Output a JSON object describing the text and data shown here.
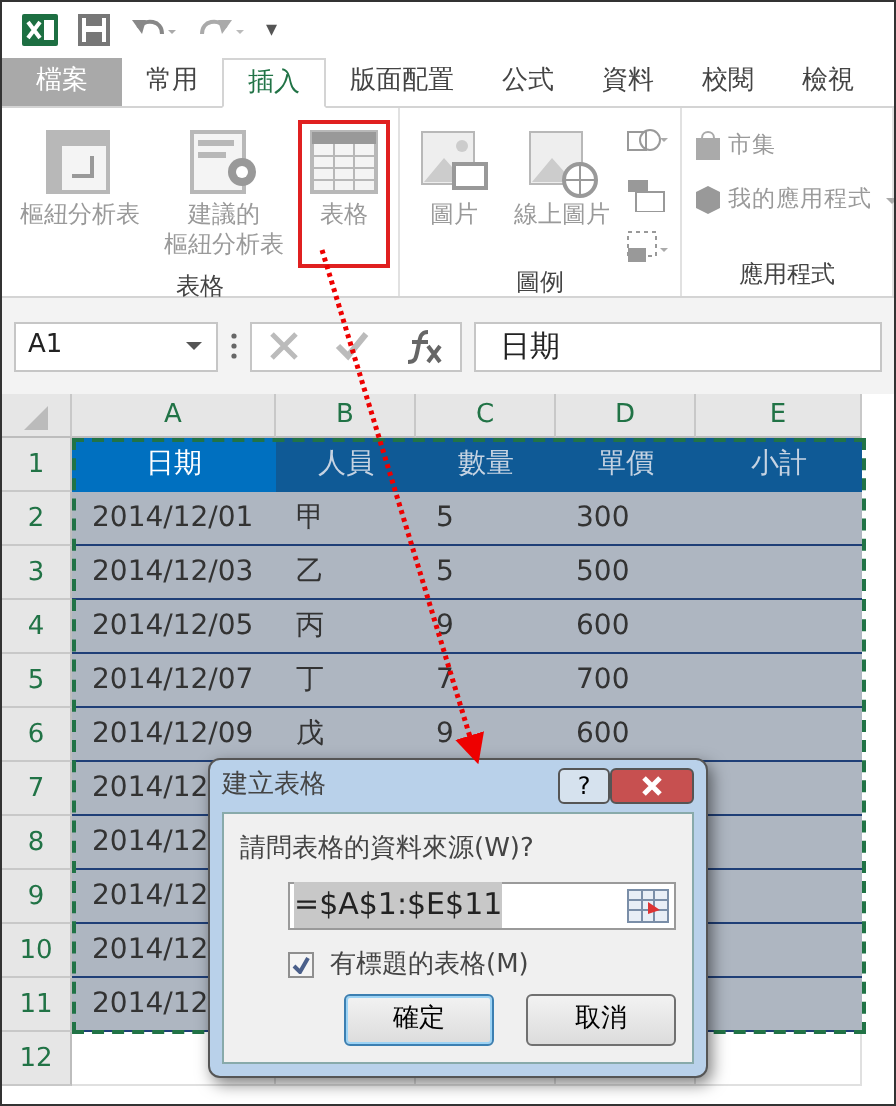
{
  "quick_access": {
    "customize_glyph": "▾"
  },
  "tabs": [
    {
      "label": "檔案",
      "kind": "file",
      "selected": false
    },
    {
      "label": "常用",
      "kind": "tab",
      "selected": false
    },
    {
      "label": "插入",
      "kind": "tab",
      "selected": true
    },
    {
      "label": "版面配置",
      "kind": "tab",
      "selected": false
    },
    {
      "label": "公式",
      "kind": "tab",
      "selected": false
    },
    {
      "label": "資料",
      "kind": "tab",
      "selected": false
    },
    {
      "label": "校閱",
      "kind": "tab",
      "selected": false
    },
    {
      "label": "檢視",
      "kind": "tab",
      "selected": false
    }
  ],
  "ribbon_groups": [
    {
      "label": "表格",
      "kind": "large",
      "items": [
        {
          "label_lines": [
            "樞紐分析表"
          ],
          "highlighted": false
        },
        {
          "label_lines": [
            "建議的",
            "樞紐分析表"
          ],
          "highlighted": false
        },
        {
          "label_lines": [
            "表格"
          ],
          "highlighted": true
        }
      ]
    },
    {
      "label": "圖例",
      "kind": "large_with_small",
      "items": [
        {
          "label_lines": [
            "圖片"
          ],
          "highlighted": false
        },
        {
          "label_lines": [
            "線上圖片"
          ],
          "highlighted": false
        }
      ]
    },
    {
      "label": "應用程式",
      "kind": "list",
      "items": [
        {
          "label": "市集",
          "dropdown": false
        },
        {
          "label": "我的應用程式",
          "dropdown": true
        }
      ]
    }
  ],
  "name_box": "A1",
  "formula": "日期",
  "columns": [
    "A",
    "B",
    "C",
    "D",
    "E"
  ],
  "table": {
    "marquee": true,
    "rows": [
      {
        "number": "1",
        "kind": "header",
        "cells": [
          {
            "text": "日期",
            "active": true
          },
          {
            "text": "人員",
            "active": false
          },
          {
            "text": "數量",
            "active": false
          },
          {
            "text": "單價",
            "active": false
          },
          {
            "text": "小計",
            "active": false
          }
        ]
      },
      {
        "number": "2",
        "kind": "data",
        "cells": [
          "2014/12/01",
          "甲",
          "5",
          "300"
        ]
      },
      {
        "number": "3",
        "kind": "data",
        "cells": [
          "2014/12/03",
          "乙",
          "5",
          "500"
        ]
      },
      {
        "number": "4",
        "kind": "data",
        "cells": [
          "2014/12/05",
          "丙",
          "9",
          "600"
        ]
      },
      {
        "number": "5",
        "kind": "data",
        "cells": [
          "2014/12/07",
          "丁",
          "7",
          "700"
        ]
      },
      {
        "number": "6",
        "kind": "data",
        "cells": [
          "2014/12/09",
          "戊",
          "9",
          "600"
        ]
      },
      {
        "number": "7",
        "kind": "data",
        "cells": [
          "2014/12"
        ]
      },
      {
        "number": "8",
        "kind": "data",
        "cells": [
          "2014/12"
        ]
      },
      {
        "number": "9",
        "kind": "data",
        "cells": [
          "2014/12"
        ]
      },
      {
        "number": "10",
        "kind": "data",
        "cells": [
          "2014/12"
        ]
      },
      {
        "number": "11",
        "kind": "data",
        "cells": [
          "2014/12"
        ]
      },
      {
        "number": "12",
        "kind": "empty"
      }
    ]
  },
  "dialog": {
    "title": "建立表格",
    "help_glyph": "?",
    "prompt": "請問表格的資料來源(W)?",
    "range": "=$A$1:$E$11",
    "range_selected": true,
    "checkbox": {
      "label": "有標題的表格(M)",
      "checked": true
    },
    "buttons": [
      {
        "label": "確定",
        "default": true
      },
      {
        "label": "取消",
        "default": false
      }
    ]
  }
}
